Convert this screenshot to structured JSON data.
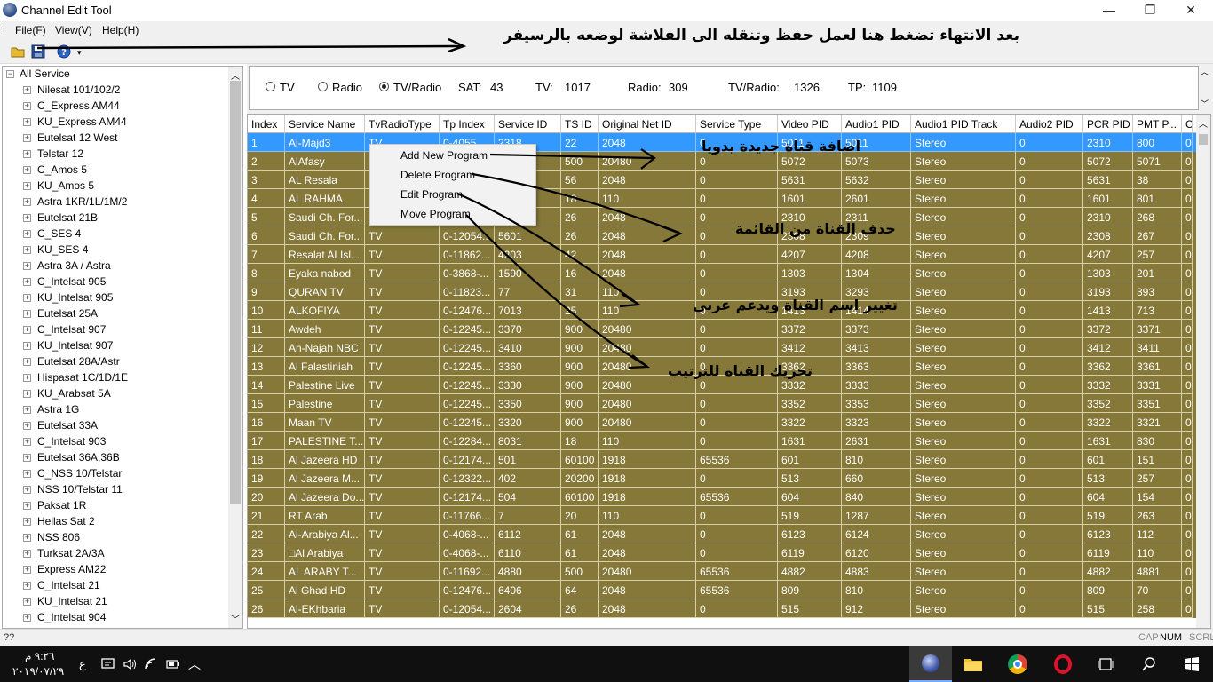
{
  "window": {
    "title": "Channel Edit Tool",
    "minimize": "—",
    "maximize": "❐",
    "close": "✕"
  },
  "menu": [
    "File(F)",
    "View(V)",
    "Help(H)"
  ],
  "toolbar_annotation": "بعد الانتهاء  تضغط هنا لعمل حفظ وتنقله الى الفلاشة لوضعه بالرسيفر",
  "tree": {
    "root": "All Service",
    "items": [
      "Nilesat 101/102/2",
      "C_Express AM44",
      "KU_Express AM44",
      "Eutelsat 12 West",
      "Telstar 12",
      "C_Amos 5",
      "KU_Amos 5",
      "Astra 1KR/1L/1M/2",
      "Eutelsat 21B",
      "C_SES 4",
      "KU_SES 4",
      "Astra 3A / Astra",
      "C_Intelsat 905",
      "KU_Intelsat 905",
      "Eutelsat 25A",
      "C_Intelsat 907",
      "KU_Intelsat 907",
      "Eutelsat 28A/Astr",
      "Hispasat 1C/1D/1E",
      "KU_Arabsat 5A",
      "Astra 1G",
      "Eutelsat 33A",
      "C_Intelsat 903",
      "Eutelsat 36A,36B",
      "C_NSS 10/Telstar",
      "NSS 10/Telstar 11",
      "Paksat 1R",
      "Hellas Sat 2",
      "NSS 806",
      "Turksat 2A/3A",
      "Express AM22",
      "C_Intelsat 21",
      "KU_Intelsat 21",
      "C_Intelsat 904"
    ]
  },
  "filter": {
    "tv": "TV",
    "radio": "Radio",
    "tvradio": "TV/Radio",
    "sat_label": "SAT:",
    "sat_value": "43",
    "tv_label": "TV:",
    "tv_value": "1017",
    "radio_label": "Radio:",
    "radio_value": "309",
    "tvradio_label": "TV/Radio:",
    "tvradio_value": "1326",
    "tp_label": "TP:",
    "tp_value": "1109"
  },
  "grid": {
    "columns": [
      "Index",
      "Service Name",
      "TvRadioType",
      "Tp Index",
      "Service ID",
      "TS ID",
      "Original Net ID",
      "Service Type",
      "Video PID",
      "Audio1 PID",
      "Audio1 PID Track",
      "Audio2 PID",
      "PCR PID",
      "PMT P...",
      "C"
    ],
    "rows": [
      [
        "1",
        "Al-Majd3",
        "TV",
        "0-4055...",
        "2318",
        "22",
        "2048",
        "0",
        "5011",
        "5011",
        "Stereo",
        "0",
        "2310",
        "800",
        "0"
      ],
      [
        "2",
        "AlAfasy",
        "",
        "",
        "",
        "500",
        "20480",
        "0",
        "5072",
        "5073",
        "Stereo",
        "0",
        "5072",
        "5071",
        "0"
      ],
      [
        "3",
        "AL Resala",
        "",
        "",
        "",
        "56",
        "2048",
        "0",
        "5631",
        "5632",
        "Stereo",
        "0",
        "5631",
        "38",
        "0"
      ],
      [
        "4",
        "AL RAHMA",
        "",
        "",
        "",
        "18",
        "110",
        "0",
        "1601",
        "2601",
        "Stereo",
        "0",
        "1601",
        "801",
        "0"
      ],
      [
        "5",
        "Saudi Ch. For...",
        "",
        "",
        "",
        "26",
        "2048",
        "0",
        "2310",
        "2311",
        "Stereo",
        "0",
        "2310",
        "268",
        "0"
      ],
      [
        "6",
        "Saudi Ch. For...",
        "TV",
        "0-12054...",
        "5601",
        "26",
        "2048",
        "0",
        "2308",
        "2309",
        "Stereo",
        "0",
        "2308",
        "267",
        "0"
      ],
      [
        "7",
        "Resalat ALIsl...",
        "TV",
        "0-11862...",
        "4203",
        "42",
        "2048",
        "0",
        "4207",
        "4208",
        "Stereo",
        "0",
        "4207",
        "257",
        "0"
      ],
      [
        "8",
        "Eyaka nabod",
        "TV",
        "0-3868-...",
        "1590",
        "16",
        "2048",
        "0",
        "1303",
        "1304",
        "Stereo",
        "0",
        "1303",
        "201",
        "0"
      ],
      [
        "9",
        "QURAN TV",
        "TV",
        "0-11823...",
        "77",
        "31",
        "110",
        "0",
        "3193",
        "3293",
        "Stereo",
        "0",
        "3193",
        "393",
        "0"
      ],
      [
        "10",
        "ALKOFIYA",
        "TV",
        "0-12476...",
        "7013",
        "25",
        "110",
        "0",
        "1413",
        "1414",
        "Stereo",
        "0",
        "1413",
        "713",
        "0"
      ],
      [
        "11",
        "Awdeh",
        "TV",
        "0-12245...",
        "3370",
        "900",
        "20480",
        "0",
        "3372",
        "3373",
        "Stereo",
        "0",
        "3372",
        "3371",
        "0"
      ],
      [
        "12",
        "An-Najah NBC",
        "TV",
        "0-12245...",
        "3410",
        "900",
        "20480",
        "0",
        "3412",
        "3413",
        "Stereo",
        "0",
        "3412",
        "3411",
        "0"
      ],
      [
        "13",
        "Al Falastiniah",
        "TV",
        "0-12245...",
        "3360",
        "900",
        "20480",
        "0",
        "3362",
        "3363",
        "Stereo",
        "0",
        "3362",
        "3361",
        "0"
      ],
      [
        "14",
        "Palestine Live",
        "TV",
        "0-12245...",
        "3330",
        "900",
        "20480",
        "0",
        "3332",
        "3333",
        "Stereo",
        "0",
        "3332",
        "3331",
        "0"
      ],
      [
        "15",
        "Palestine",
        "TV",
        "0-12245...",
        "3350",
        "900",
        "20480",
        "0",
        "3352",
        "3353",
        "Stereo",
        "0",
        "3352",
        "3351",
        "0"
      ],
      [
        "16",
        "Maan TV",
        "TV",
        "0-12245...",
        "3320",
        "900",
        "20480",
        "0",
        "3322",
        "3323",
        "Stereo",
        "0",
        "3322",
        "3321",
        "0"
      ],
      [
        "17",
        "PALESTINE T...",
        "TV",
        "0-12284...",
        "8031",
        "18",
        "110",
        "0",
        "1631",
        "2631",
        "Stereo",
        "0",
        "1631",
        "830",
        "0"
      ],
      [
        "18",
        "Al Jazeera HD",
        "TV",
        "0-12174...",
        "501",
        "60100",
        "1918",
        "65536",
        "601",
        "810",
        "Stereo",
        "0",
        "601",
        "151",
        "0"
      ],
      [
        "19",
        "Al Jazeera M...",
        "TV",
        "0-12322...",
        "402",
        "20200",
        "1918",
        "0",
        "513",
        "660",
        "Stereo",
        "0",
        "513",
        "257",
        "0"
      ],
      [
        "20",
        "Al Jazeera Do...",
        "TV",
        "0-12174...",
        "504",
        "60100",
        "1918",
        "65536",
        "604",
        "840",
        "Stereo",
        "0",
        "604",
        "154",
        "0"
      ],
      [
        "21",
        "RT Arab",
        "TV",
        "0-11766...",
        "7",
        "20",
        "110",
        "0",
        "519",
        "1287",
        "Stereo",
        "0",
        "519",
        "263",
        "0"
      ],
      [
        "22",
        "Al-Arabiya Al...",
        "TV",
        "0-4068-...",
        "6112",
        "61",
        "2048",
        "0",
        "6123",
        "6124",
        "Stereo",
        "0",
        "6123",
        "112",
        "0"
      ],
      [
        "23",
        "□Al Arabiya",
        "TV",
        "0-4068-...",
        "6110",
        "61",
        "2048",
        "0",
        "6119",
        "6120",
        "Stereo",
        "0",
        "6119",
        "110",
        "0"
      ],
      [
        "24",
        "AL ARABY T...",
        "TV",
        "0-11692...",
        "4880",
        "500",
        "20480",
        "65536",
        "4882",
        "4883",
        "Stereo",
        "0",
        "4882",
        "4881",
        "0"
      ],
      [
        "25",
        "Al Ghad HD",
        "TV",
        "0-12476...",
        "6406",
        "64",
        "2048",
        "65536",
        "809",
        "810",
        "Stereo",
        "0",
        "809",
        "70",
        "0"
      ],
      [
        "26",
        "Al-EKhbaria",
        "TV",
        "0-12054...",
        "2604",
        "26",
        "2048",
        "0",
        "515",
        "912",
        "Stereo",
        "0",
        "515",
        "258",
        "0"
      ]
    ]
  },
  "context_menu": [
    "Add New Program",
    "Delete Program",
    "Edit Program",
    "Move Program"
  ],
  "annotations": {
    "add": "اضافة قناة جديدة يدويا",
    "delete": "حذف القناة من القائمة",
    "edit": "تغيير اسم القناة ويدعم عربي",
    "move": "تحريك القناة للترتيب"
  },
  "status": {
    "left": "??",
    "cap": "CAP",
    "num": "NUM",
    "scrl": "SCRL"
  },
  "taskbar": {
    "time": "٩:٢٦ م",
    "date": "٢٠١٩/٠٧/٢٩",
    "lang": "ع"
  },
  "colors": {
    "row_bg": "#857838",
    "selected_bg": "#3399ff"
  }
}
